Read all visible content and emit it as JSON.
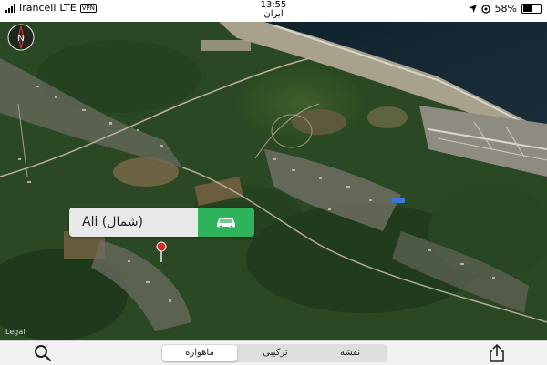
{
  "status_bar": {
    "carrier": "Irancell",
    "network": "LTE",
    "vpn": "VPN",
    "time": "13:55",
    "region": "ایران",
    "battery": "58%",
    "battery_level": 0.58
  },
  "map": {
    "compass_label": "N",
    "legal_label": "Legal"
  },
  "callout": {
    "label": "Ali (شمال)",
    "action_icon": "car-icon",
    "action_color": "#2fb35a"
  },
  "pin": {
    "icon": "map-pin-icon",
    "color": "#e0262b"
  },
  "toolbar": {
    "search_icon": "search-icon",
    "share_icon": "share-icon",
    "map_types": [
      {
        "label": "ماهواره",
        "selected": true
      },
      {
        "label": "ترکیبی",
        "selected": false
      },
      {
        "label": "نقشه",
        "selected": false
      }
    ]
  }
}
